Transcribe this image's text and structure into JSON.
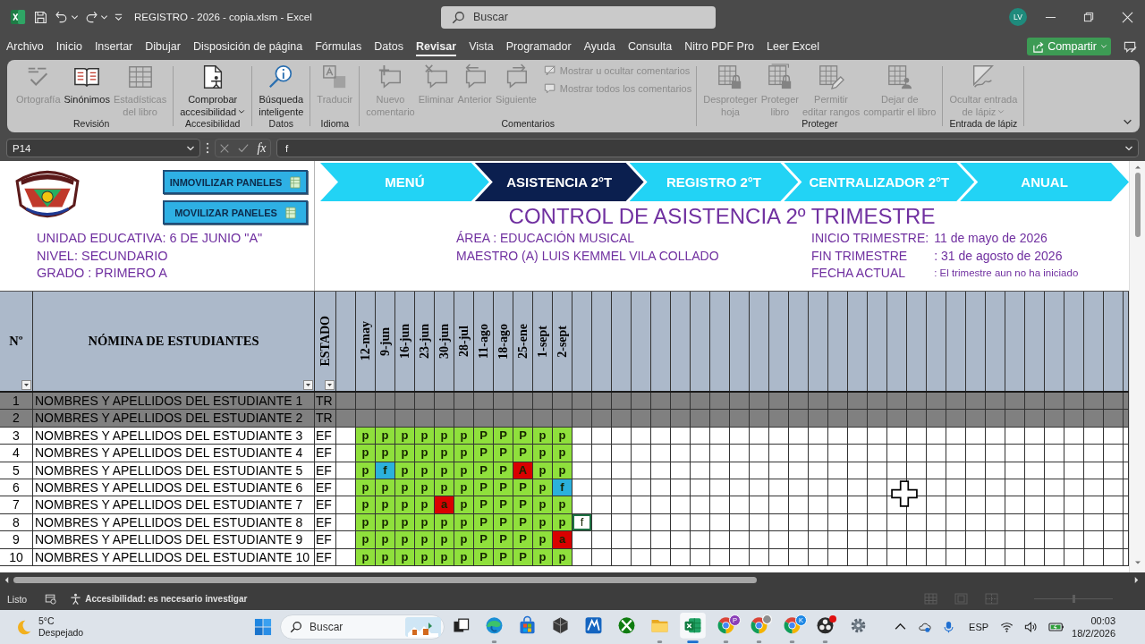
{
  "title_bar": {
    "title": "REGISTRO - 2026 - copia.xlsm - Excel",
    "search": {
      "placeholder": "Buscar"
    },
    "avatar": "LV"
  },
  "menu_tabs": [
    {
      "label": "Archivo",
      "selected": false
    },
    {
      "label": "Inicio",
      "selected": false
    },
    {
      "label": "Insertar",
      "selected": false
    },
    {
      "label": "Dibujar",
      "selected": false
    },
    {
      "label": "Disposición de página",
      "selected": false
    },
    {
      "label": "Fórmulas",
      "selected": false
    },
    {
      "label": "Datos",
      "selected": false
    },
    {
      "label": "Revisar",
      "selected": true
    },
    {
      "label": "Vista",
      "selected": false
    },
    {
      "label": "Programador",
      "selected": false
    },
    {
      "label": "Ayuda",
      "selected": false
    },
    {
      "label": "Consulta",
      "selected": false
    },
    {
      "label": "Nitro PDF Pro",
      "selected": false
    },
    {
      "label": "Leer Excel",
      "selected": false
    }
  ],
  "share_button": {
    "label": "Compartir"
  },
  "ribbon": {
    "groups": [
      {
        "name": "Revisión",
        "buttons": [
          {
            "lines": [
              "Ortografía"
            ],
            "disabled": true,
            "dropdown": false
          },
          {
            "lines": [
              "Sinónimos"
            ],
            "disabled": false,
            "dropdown": false
          },
          {
            "lines": [
              "Estadísticas",
              "del libro"
            ],
            "disabled": true,
            "dropdown": false
          }
        ]
      },
      {
        "name": "Accesibilidad",
        "buttons": [
          {
            "lines": [
              "Comprobar",
              "accesibilidad"
            ],
            "disabled": false,
            "dropdown": true
          }
        ]
      },
      {
        "name": "Datos",
        "buttons": [
          {
            "lines": [
              "Búsqueda",
              "inteligente"
            ],
            "disabled": false,
            "dropdown": false
          }
        ]
      },
      {
        "name": "Idioma",
        "buttons": [
          {
            "lines": [
              "Traducir"
            ],
            "disabled": true,
            "dropdown": false
          }
        ]
      },
      {
        "name": "Comentarios",
        "buttons": [
          {
            "lines": [
              "Nuevo",
              "comentario"
            ],
            "disabled": true,
            "dropdown": false
          },
          {
            "lines": [
              "Eliminar"
            ],
            "disabled": true,
            "dropdown": false
          },
          {
            "lines": [
              "Anterior"
            ],
            "disabled": true,
            "dropdown": false
          },
          {
            "lines": [
              "Siguiente"
            ],
            "disabled": true,
            "dropdown": false
          }
        ],
        "small_buttons": [
          {
            "label": "Mostrar u ocultar comentarios",
            "disabled": true
          },
          {
            "label": "Mostrar todos los comentarios",
            "disabled": true
          }
        ]
      },
      {
        "name": "Proteger",
        "buttons": [
          {
            "lines": [
              "Desproteger",
              "hoja"
            ],
            "disabled": true,
            "dropdown": false
          },
          {
            "lines": [
              "Proteger",
              "libro"
            ],
            "disabled": true,
            "dropdown": false
          },
          {
            "lines": [
              "Permitir",
              "editar rangos"
            ],
            "disabled": true,
            "dropdown": false
          },
          {
            "lines": [
              "Dejar de",
              "compartir el libro"
            ],
            "disabled": true,
            "dropdown": false
          }
        ]
      },
      {
        "name": "Entrada de lápiz",
        "buttons": [
          {
            "lines": [
              "Ocultar entrada",
              "de lápiz"
            ],
            "disabled": true,
            "dropdown": true
          }
        ]
      }
    ]
  },
  "formula_bar": {
    "name_box": "P14",
    "function_button": "fx",
    "formula": "f"
  },
  "sheet": {
    "panel_buttons": [
      "INMOVILIZAR PANELES",
      "MOVILIZAR PANELES"
    ],
    "nav_tabs": [
      {
        "label": "MENÚ",
        "selected": false
      },
      {
        "label": "ASISTENCIA 2°T",
        "selected": true
      },
      {
        "label": "REGISTRO 2°T",
        "selected": false
      },
      {
        "label": "CENTRALIZADOR 2°T",
        "selected": false
      },
      {
        "label": "ANUAL",
        "selected": false
      }
    ],
    "title": "CONTROL DE ASISTENCIA 2º TRIMESTRE",
    "school_info": [
      "UNIDAD EDUCATIVA: 6 DE JUNIO \"A\"",
      "NIVEL: SECUNDARIO",
      "GRADO : PRIMERO A"
    ],
    "course_info": [
      "ÁREA : EDUCACIÓN MUSICAL",
      "MAESTRO (A) LUIS KEMMEL VILA COLLADO"
    ],
    "term_info": [
      {
        "label": "INICIO TRIMESTRE:",
        "value": "11 de mayo de 2026"
      },
      {
        "label": "FIN TRIMESTRE",
        "value": ": 31 de agosto de 2026"
      },
      {
        "label": "FECHA ACTUAL",
        "value": ": El trimestre aun no ha iniciado"
      }
    ],
    "table": {
      "columns": {
        "number": "Nº",
        "name": "NÓMINA DE ESTUDIANTES",
        "status": "ESTADO",
        "dates": [
          "12-may",
          "9-jun",
          "16-jun",
          "23-jun",
          "30-jun",
          "28-jul",
          "11-ago",
          "18-ago",
          "25-ene",
          "1-sept",
          "2-sept"
        ]
      },
      "rows": [
        {
          "number": "1",
          "name": "NOMBRES Y APELLIDOS DEL ESTUDIANTE 1",
          "status": "TR",
          "inactive": true
        },
        {
          "number": "2",
          "name": "NOMBRES Y APELLIDOS DEL ESTUDIANTE 2",
          "status": "TR",
          "inactive": true
        },
        {
          "number": "3",
          "name": "NOMBRES Y APELLIDOS DEL ESTUDIANTE 3",
          "status": "EF",
          "inactive": false,
          "cells": [
            {
              "text": "p",
              "color": "#8fe03c",
              "selected": false
            },
            {
              "text": "p",
              "color": "#8fe03c",
              "selected": false
            },
            {
              "text": "p",
              "color": "#8fe03c",
              "selected": false
            },
            {
              "text": "p",
              "color": "#8fe03c",
              "selected": false
            },
            {
              "text": "p",
              "color": "#8fe03c",
              "selected": false
            },
            {
              "text": "p",
              "color": "#8fe03c",
              "selected": false
            },
            {
              "text": "P",
              "color": "#8fe03c",
              "selected": false
            },
            {
              "text": "P",
              "color": "#8fe03c",
              "selected": false
            },
            {
              "text": "P",
              "color": "#8fe03c",
              "selected": false
            },
            {
              "text": "p",
              "color": "#8fe03c",
              "selected": false
            },
            {
              "text": "p",
              "color": "#8fe03c",
              "selected": false
            }
          ]
        },
        {
          "number": "4",
          "name": "NOMBRES Y APELLIDOS DEL ESTUDIANTE 4",
          "status": "EF",
          "inactive": false,
          "cells": [
            {
              "text": "p",
              "color": "#8fe03c",
              "selected": false
            },
            {
              "text": "p",
              "color": "#8fe03c",
              "selected": false
            },
            {
              "text": "p",
              "color": "#8fe03c",
              "selected": false
            },
            {
              "text": "p",
              "color": "#8fe03c",
              "selected": false
            },
            {
              "text": "p",
              "color": "#8fe03c",
              "selected": false
            },
            {
              "text": "p",
              "color": "#8fe03c",
              "selected": false
            },
            {
              "text": "P",
              "color": "#8fe03c",
              "selected": false
            },
            {
              "text": "P",
              "color": "#8fe03c",
              "selected": false
            },
            {
              "text": "P",
              "color": "#8fe03c",
              "selected": false
            },
            {
              "text": "p",
              "color": "#8fe03c",
              "selected": false
            },
            {
              "text": "p",
              "color": "#8fe03c",
              "selected": false
            }
          ]
        },
        {
          "number": "5",
          "name": "NOMBRES Y APELLIDOS DEL ESTUDIANTE 5",
          "status": "EF",
          "inactive": false,
          "cells": [
            {
              "text": "p",
              "color": "#8fe03c",
              "selected": false
            },
            {
              "text": "f",
              "color": "#2bb1dc",
              "selected": false
            },
            {
              "text": "p",
              "color": "#8fe03c",
              "selected": false
            },
            {
              "text": "p",
              "color": "#8fe03c",
              "selected": false
            },
            {
              "text": "p",
              "color": "#8fe03c",
              "selected": false
            },
            {
              "text": "p",
              "color": "#8fe03c",
              "selected": false
            },
            {
              "text": "P",
              "color": "#8fe03c",
              "selected": false
            },
            {
              "text": "P",
              "color": "#8fe03c",
              "selected": false
            },
            {
              "text": "A",
              "color": "#d90000",
              "selected": false
            },
            {
              "text": "p",
              "color": "#8fe03c",
              "selected": false
            },
            {
              "text": "p",
              "color": "#8fe03c",
              "selected": false
            }
          ]
        },
        {
          "number": "6",
          "name": "NOMBRES Y APELLIDOS DEL ESTUDIANTE 6",
          "status": "EF",
          "inactive": false,
          "cells": [
            {
              "text": "p",
              "color": "#8fe03c",
              "selected": false
            },
            {
              "text": "p",
              "color": "#8fe03c",
              "selected": false
            },
            {
              "text": "p",
              "color": "#8fe03c",
              "selected": false
            },
            {
              "text": "p",
              "color": "#8fe03c",
              "selected": false
            },
            {
              "text": "p",
              "color": "#8fe03c",
              "selected": false
            },
            {
              "text": "p",
              "color": "#8fe03c",
              "selected": false
            },
            {
              "text": "P",
              "color": "#8fe03c",
              "selected": false
            },
            {
              "text": "P",
              "color": "#8fe03c",
              "selected": false
            },
            {
              "text": "P",
              "color": "#8fe03c",
              "selected": false
            },
            {
              "text": "p",
              "color": "#8fe03c",
              "selected": false
            },
            {
              "text": "f",
              "color": "#2bb1dc",
              "selected": false
            }
          ]
        },
        {
          "number": "7",
          "name": "NOMBRES Y APELLIDOS DEL ESTUDIANTE 7",
          "status": "EF",
          "inactive": false,
          "cells": [
            {
              "text": "p",
              "color": "#8fe03c",
              "selected": false
            },
            {
              "text": "p",
              "color": "#8fe03c",
              "selected": false
            },
            {
              "text": "p",
              "color": "#8fe03c",
              "selected": false
            },
            {
              "text": "p",
              "color": "#8fe03c",
              "selected": false
            },
            {
              "text": "a",
              "color": "#d90000",
              "selected": false
            },
            {
              "text": "p",
              "color": "#8fe03c",
              "selected": false
            },
            {
              "text": "P",
              "color": "#8fe03c",
              "selected": false
            },
            {
              "text": "P",
              "color": "#8fe03c",
              "selected": false
            },
            {
              "text": "P",
              "color": "#8fe03c",
              "selected": false
            },
            {
              "text": "p",
              "color": "#8fe03c",
              "selected": false
            },
            {
              "text": "p",
              "color": "#8fe03c",
              "selected": false
            }
          ]
        },
        {
          "number": "8",
          "name": "NOMBRES Y APELLIDOS DEL ESTUDIANTE 8",
          "status": "EF",
          "inactive": false,
          "cells": [
            {
              "text": "p",
              "color": "#8fe03c",
              "selected": false
            },
            {
              "text": "p",
              "color": "#8fe03c",
              "selected": false
            },
            {
              "text": "p",
              "color": "#8fe03c",
              "selected": false
            },
            {
              "text": "p",
              "color": "#8fe03c",
              "selected": false
            },
            {
              "text": "p",
              "color": "#8fe03c",
              "selected": false
            },
            {
              "text": "p",
              "color": "#8fe03c",
              "selected": false
            },
            {
              "text": "P",
              "color": "#8fe03c",
              "selected": false
            },
            {
              "text": "P",
              "color": "#8fe03c",
              "selected": false
            },
            {
              "text": "P",
              "color": "#8fe03c",
              "selected": false
            },
            {
              "text": "p",
              "color": "#8fe03c",
              "selected": false
            },
            {
              "text": "p",
              "color": "#8fe03c",
              "selected": false
            },
            {
              "text": "f",
              "color": "#ffffff",
              "selected": true
            }
          ]
        },
        {
          "number": "9",
          "name": "NOMBRES Y APELLIDOS DEL ESTUDIANTE 9",
          "status": "EF",
          "inactive": false,
          "cells": [
            {
              "text": "p",
              "color": "#8fe03c",
              "selected": false
            },
            {
              "text": "p",
              "color": "#8fe03c",
              "selected": false
            },
            {
              "text": "p",
              "color": "#8fe03c",
              "selected": false
            },
            {
              "text": "p",
              "color": "#8fe03c",
              "selected": false
            },
            {
              "text": "p",
              "color": "#8fe03c",
              "selected": false
            },
            {
              "text": "p",
              "color": "#8fe03c",
              "selected": false
            },
            {
              "text": "P",
              "color": "#8fe03c",
              "selected": false
            },
            {
              "text": "P",
              "color": "#8fe03c",
              "selected": false
            },
            {
              "text": "P",
              "color": "#8fe03c",
              "selected": false
            },
            {
              "text": "p",
              "color": "#8fe03c",
              "selected": false
            },
            {
              "text": "a",
              "color": "#d90000",
              "selected": false
            }
          ]
        },
        {
          "number": "10",
          "name": "NOMBRES Y APELLIDOS DEL ESTUDIANTE 10",
          "status": "EF",
          "inactive": false,
          "cells": [
            {
              "text": "p",
              "color": "#8fe03c",
              "selected": false
            },
            {
              "text": "p",
              "color": "#8fe03c",
              "selected": false
            },
            {
              "text": "p",
              "color": "#8fe03c",
              "selected": false
            },
            {
              "text": "p",
              "color": "#8fe03c",
              "selected": false
            },
            {
              "text": "p",
              "color": "#8fe03c",
              "selected": false
            },
            {
              "text": "p",
              "color": "#8fe03c",
              "selected": false
            },
            {
              "text": "P",
              "color": "#8fe03c",
              "selected": false
            },
            {
              "text": "P",
              "color": "#8fe03c",
              "selected": false
            },
            {
              "text": "P",
              "color": "#8fe03c",
              "selected": false
            },
            {
              "text": "p",
              "color": "#8fe03c",
              "selected": false
            },
            {
              "text": "p",
              "color": "#8fe03c",
              "selected": false
            }
          ]
        }
      ]
    }
  },
  "status_bar": {
    "status": "Listo",
    "accessibility": "Accesibilidad: es necesario investigar",
    "zoom": {
      "level": 0.5
    }
  },
  "taskbar": {
    "weather": {
      "temperature": "5°C",
      "condition": "Despejado"
    },
    "search": {
      "placeholder": "Buscar"
    },
    "apps": [
      {
        "running": false,
        "active": false,
        "notification": false
      },
      {
        "running": true,
        "active": false,
        "notification": false
      },
      {
        "running": false,
        "active": false,
        "notification": false
      },
      {
        "running": false,
        "active": false,
        "notification": false
      },
      {
        "running": false,
        "active": false,
        "notification": false
      },
      {
        "running": false,
        "active": false,
        "notification": false
      },
      {
        "running": true,
        "active": false,
        "notification": false
      },
      {
        "running": true,
        "active": true,
        "notification": false
      },
      {
        "running": true,
        "active": false,
        "notification": false,
        "profile": {
          "kind": "letter",
          "text": "P"
        }
      },
      {
        "running": true,
        "active": false,
        "notification": false,
        "profile": {
          "kind": "photo"
        }
      },
      {
        "running": true,
        "active": false,
        "notification": false,
        "profile": {
          "kind": "letter",
          "text": "K"
        }
      },
      {
        "running": true,
        "active": false,
        "notification": true
      },
      {
        "running": false,
        "active": false,
        "notification": false
      }
    ],
    "language": "ESP",
    "time": "00:03",
    "date": "18/2/2026"
  }
}
